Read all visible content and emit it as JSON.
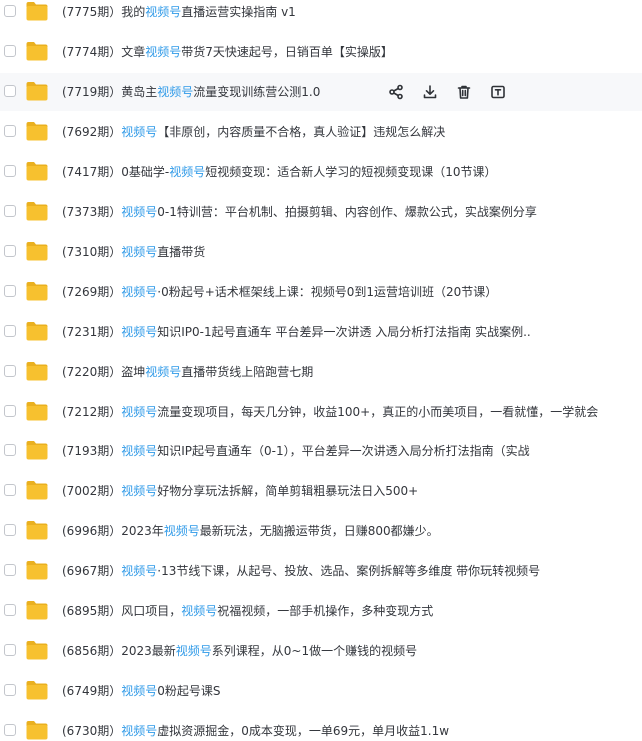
{
  "rows": [
    {
      "parts": [
        "(7775期）我的",
        "视频号",
        "直播运营实操指南 v1"
      ]
    },
    {
      "parts": [
        "(7774期）文章",
        "视频号",
        "带货7天快速起号，日销百单【实操版】"
      ]
    },
    {
      "parts": [
        "(7719期）黄岛主",
        "视频号",
        "流量变现训练营公测1.0"
      ]
    },
    {
      "parts": [
        "(7692期）",
        "视频号",
        "【非原创，内容质量不合格，真人验证】违规怎么解决"
      ]
    },
    {
      "parts": [
        "(7417期）0基础学-",
        "视频号",
        "短视频变现：适合新人学习的短视频变现课（10节课）"
      ]
    },
    {
      "parts": [
        "(7373期）",
        "视频号",
        "0-1特训营：平台机制、拍摄剪辑、内容创作、爆款公式，实战案例分享"
      ]
    },
    {
      "parts": [
        "(7310期）",
        "视频号",
        "直播带货"
      ]
    },
    {
      "parts": [
        "(7269期）",
        "视频号",
        "·0粉起号+话术框架线上课：视频号0到1运营培训班（20节课）"
      ]
    },
    {
      "parts": [
        "(7231期）",
        "视频号",
        "知识IP0-1起号直通车 平台差异一次讲透 入局分析打法指南 实战案例.."
      ]
    },
    {
      "parts": [
        "(7220期）盗坤",
        "视频号",
        "直播带货线上陪跑营七期"
      ]
    },
    {
      "parts": [
        "(7212期）",
        "视频号",
        "流量变现项目，每天几分钟，收益100+，真正的小而美项目，一看就懂，一学就会"
      ]
    },
    {
      "parts": [
        "(7193期）",
        "视频号",
        "知识IP起号直通车（0-1），平台差异一次讲透入局分析打法指南（实战"
      ]
    },
    {
      "parts": [
        "(7002期）",
        "视频号",
        "好物分享玩法拆解，简单剪辑粗暴玩法日入500+"
      ]
    },
    {
      "parts": [
        "(6996期）2023年",
        "视频号",
        "最新玩法，无脑搬运带货，日赚800都嫌少。"
      ]
    },
    {
      "parts": [
        "(6967期）",
        "视频号",
        "·13节线下课，从起号、投放、选品、案例拆解等多维度 带你玩转视频号"
      ]
    },
    {
      "parts": [
        "(6895期）风口项目，",
        "视频号",
        "祝福视频，一部手机操作，多种变现方式"
      ]
    },
    {
      "parts": [
        "(6856期）2023最新",
        "视频号",
        "系列课程，从0~1做一个赚钱的视频号"
      ]
    },
    {
      "parts": [
        "(6749期）",
        "视频号",
        "0粉起号课S"
      ]
    },
    {
      "parts": [
        "(6730期）",
        "视频号",
        "虚拟资源掘金，0成本变现，一单69元，单月收益1.1w"
      ]
    }
  ],
  "hovered_row": 2,
  "actions": [
    {
      "name": "share-icon"
    },
    {
      "name": "download-icon"
    },
    {
      "name": "delete-icon"
    },
    {
      "name": "rename-icon"
    }
  ],
  "colors": {
    "keyword": "#2f9ae8",
    "text": "#33363c",
    "hover": "#f7f8fa",
    "folder": "#f7c12f"
  }
}
